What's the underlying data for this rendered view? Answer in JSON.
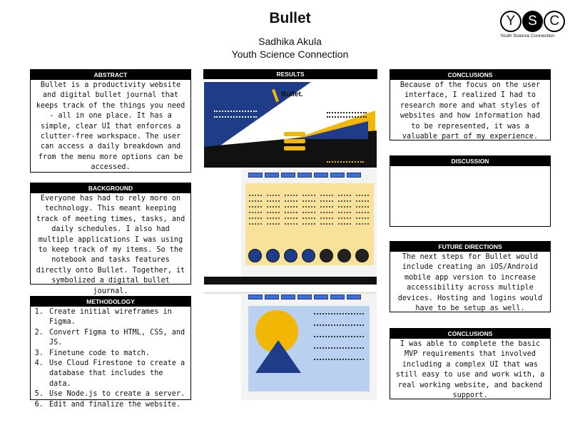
{
  "header": {
    "title": "Bullet",
    "author": "Sadhika Akula",
    "organization": "Youth Science Connection"
  },
  "logo": {
    "letters": [
      "Y",
      "S",
      "C"
    ],
    "tagline": "Youth Science Connection"
  },
  "abstract": {
    "heading": "ABSTRACT",
    "text": "Bullet is a productivity website and digital bullet journal that keeps track of the things you need - all in one place. It has a simple, clear UI that enforces a clutter-free workspace. The user can access a daily breakdown and from the menu more options can be accessed."
  },
  "background": {
    "heading": "BACKGROUND",
    "text": "Everyone has had to rely more on technology. This meant keeping track of meeting times, tasks, and daily schedules. I also had multiple applications I was using to keep track of my items. So the notebook and tasks features directly onto Bullet. Together, it symbolized a digital bullet journal."
  },
  "methodology": {
    "heading": "METHODOLOGY",
    "steps": [
      "Create initial wireframes in Figma.",
      "Convert Figma to HTML, CSS, and JS.",
      "Finetune code to match.",
      "Use Cloud Firestone to create a database that includes the data.",
      "Use Node.js to create a server.",
      "Edit and finalize the website."
    ]
  },
  "results": {
    "heading": "RESULTS",
    "app_name": "Bullet."
  },
  "conclusions_1": {
    "heading": "CONCLUSIONS",
    "text": "Because of the focus on the user interface, I realized I had to research more and what styles of websites and how information had to be represented, it was a valuable part of my experience."
  },
  "discussion": {
    "heading": "DISCUSSION",
    "text": ""
  },
  "future_directions": {
    "heading": "FUTURE DIRECTIONS",
    "text": "The next steps for Bullet would include creating an iOS/Android mobile app version to increase accessibility across multiple devices. Hosting and logins would have to be setup as well."
  },
  "conclusions_2": {
    "heading": "CONCLUSIONS",
    "text": "I was able to complete the basic MVP requirements that involved including a complex UI that was still easy to use and work with, a real working website, and backend support."
  },
  "colors": {
    "primary_blue": "#1f3c88",
    "accent_yellow": "#f2b705",
    "header_black": "#000000"
  }
}
